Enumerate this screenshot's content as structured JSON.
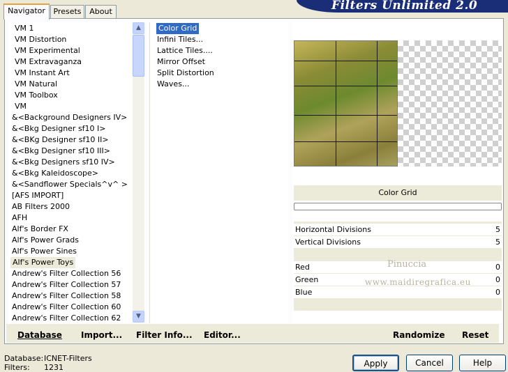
{
  "app_title": "Filters Unlimited 2.0",
  "tabs": [
    "Navigator",
    "Presets",
    "About"
  ],
  "categories": [
    "VM 1",
    "VM Distortion",
    "VM Experimental",
    "VM Extravaganza",
    "VM Instant Art",
    "VM Natural",
    "VM Toolbox",
    "VM",
    "&<Background Designers IV>",
    "&<Bkg Designer sf10 I>",
    "&<BKg Designer sf10 II>",
    "&<Bkg Designer sf10 III>",
    "&<Bkg Designers sf10 IV>",
    "&<Bkg Kaleidoscope>",
    "&<Sandflower Specials^v^ >",
    "[AFS IMPORT]",
    "AB Filters 2000",
    "AFH",
    "Alf's Border FX",
    "Alf's Power Grads",
    "Alf's Power Sines",
    "Alf's Power Toys",
    "Andrew's Filter Collection 56",
    "Andrew's Filter Collection 57",
    "Andrew's Filter Collection 58",
    "Andrew's Filter Collection 60",
    "Andrew's Filter Collection 62"
  ],
  "selected_category": "Alf's Power Toys",
  "filters": [
    "Color Grid",
    "Infini Tiles...",
    "Lattice Tiles....",
    "Mirror Offset",
    "Split Distortion",
    "Waves..."
  ],
  "selected_filter": "Color Grid",
  "preview_title": "Color Grid",
  "params": [
    {
      "label": "Horizontal Divisions",
      "value": "5"
    },
    {
      "label": "Vertical Divisions",
      "value": "5"
    },
    {
      "label": "Red",
      "value": "0"
    },
    {
      "label": "Green",
      "value": "0"
    },
    {
      "label": "Blue",
      "value": "0"
    }
  ],
  "watermark": {
    "line1": "Pinuccia",
    "line2": "www.maidiregrafica.eu"
  },
  "toolbar": {
    "database": "Database",
    "import": "Import...",
    "filter_info": "Filter Info...",
    "editor": "Editor...",
    "randomize": "Randomize",
    "reset": "Reset"
  },
  "status": {
    "database_label": "Database:",
    "database_value": "ICNET-Filters",
    "filters_label": "Filters:",
    "filters_value": "1231"
  },
  "buttons": {
    "apply": "Apply",
    "cancel": "Cancel",
    "help": "Help"
  },
  "colors": {
    "selection": "#316ac5",
    "banner": "#1a2e78",
    "dialog_bg": "#ece9d8"
  }
}
